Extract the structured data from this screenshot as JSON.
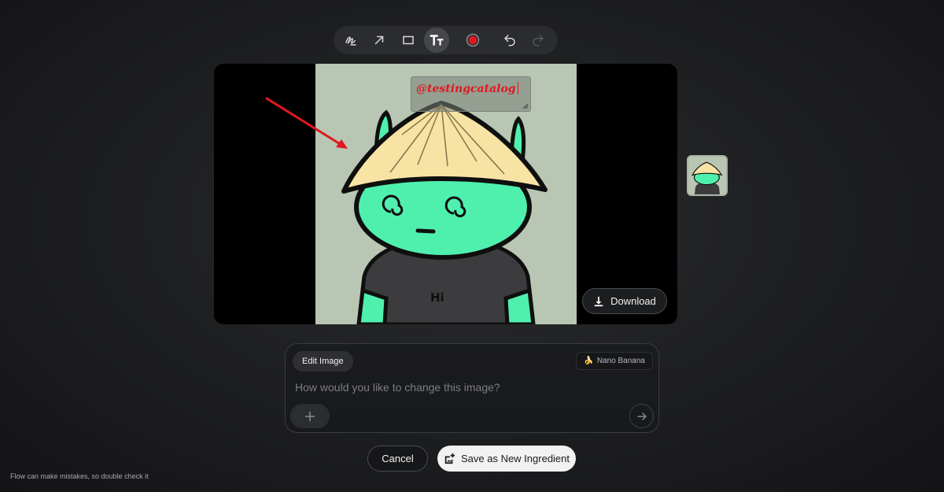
{
  "toolbar": {
    "tools": [
      {
        "name": "freehand-draw",
        "icon": "scribble-icon",
        "active": false
      },
      {
        "name": "arrow",
        "icon": "arrow-icon",
        "active": false
      },
      {
        "name": "rectangle",
        "icon": "rectangle-icon",
        "active": false
      },
      {
        "name": "text",
        "icon": "text-size-icon",
        "active": true
      },
      {
        "name": "color",
        "icon": "color-swatch-icon",
        "color": "#e0181e"
      },
      {
        "name": "undo",
        "icon": "undo-icon"
      },
      {
        "name": "redo",
        "icon": "redo-icon",
        "disabled": true
      }
    ]
  },
  "canvas": {
    "text_annotation": "@testingcatalog",
    "annotation_color": "#e0181e",
    "shirt_text": "Hi",
    "download_label": "Download"
  },
  "prompt": {
    "mode_label": "Edit Image",
    "model_label": "Nano Banana",
    "placeholder": "How would you like to change this image?"
  },
  "actions": {
    "cancel_label": "Cancel",
    "save_label": "Save as New Ingredient"
  },
  "footer": {
    "disclaimer": "Flow can make mistakes, so double check it"
  }
}
